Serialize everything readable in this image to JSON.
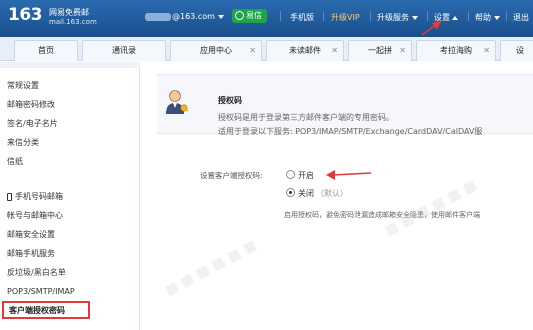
{
  "header": {
    "logo_number": "163",
    "logo_cn": "网易免费邮",
    "logo_domain": "mail.163.com",
    "account": "@163.com",
    "yixin_label": "易信",
    "links": {
      "mobile": "手机版",
      "vip": "升级VIP",
      "upgrade_service": "升级服务",
      "settings": "设置",
      "help": "帮助",
      "logout": "退出"
    }
  },
  "tabs": [
    {
      "label": "首页"
    },
    {
      "label": "通讯录"
    },
    {
      "label": "应用中心"
    },
    {
      "label": "未读邮件"
    },
    {
      "label": "一起拼"
    },
    {
      "label": "考拉海购"
    },
    {
      "label": "设"
    }
  ],
  "sidebar": {
    "items": [
      {
        "label": "常规设置"
      },
      {
        "label": "邮箱密码修改"
      },
      {
        "label": "签名/电子名片"
      },
      {
        "label": "来信分类"
      },
      {
        "label": "信纸"
      },
      {
        "label": "手机号码邮箱"
      },
      {
        "label": "帐号与邮箱中心"
      },
      {
        "label": "邮箱安全设置"
      },
      {
        "label": "邮箱手机服务"
      },
      {
        "label": "反垃圾/黑白名单"
      },
      {
        "label": "POP3/SMTP/IMAP"
      },
      {
        "label": "客户端授权密码"
      }
    ]
  },
  "main": {
    "title": "授权码",
    "description": "授权码是用于登录第三方邮件客户端的专用密码。",
    "services": "适用于登录以下服务: POP3/IMAP/SMTP/Exchange/CardDAV/CalDAV服",
    "setting_label": "设置客户端授权码:",
    "option_on": "开启",
    "option_off": "关闭",
    "option_off_default": "（默认）",
    "hint": "启用授权码，避免密码泄漏造成邮箱安全隐患，使用邮件客户端"
  },
  "colors": {
    "header_bg": "#1f5a9a",
    "accent_red": "#e23a3a",
    "yixin_green": "#1fa44a"
  }
}
